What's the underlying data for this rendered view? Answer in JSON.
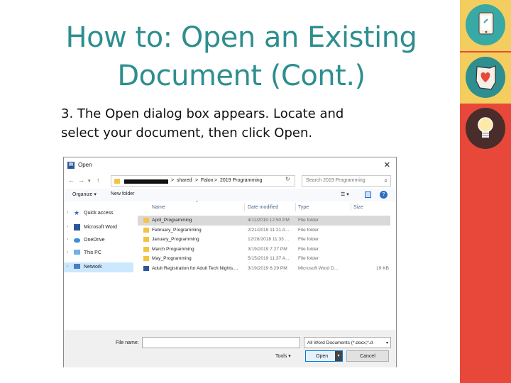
{
  "slide": {
    "title_line1": "How to: Open an Existing",
    "title_line2": "Document (Cont.)",
    "body_line1": "3.  The Open dialog box appears.  Locate and",
    "body_line2": "select your document, then click Open."
  },
  "dialog": {
    "title": "Open",
    "close_glyph": "✕",
    "address": {
      "crumb_1": "shared",
      "crumb_2": "Falon",
      "crumb_3": "2019 Programming",
      "separator": ">"
    },
    "search_placeholder": "Search 2019 Programming",
    "toolbar": {
      "organize": "Organize ▾",
      "new_folder": "New folder",
      "help": "?"
    },
    "nav": [
      {
        "label": "Quick access"
      },
      {
        "label": "Microsoft Word"
      },
      {
        "label": "OneDrive"
      },
      {
        "label": "This PC"
      },
      {
        "label": "Network"
      }
    ],
    "columns": {
      "name": "Name",
      "date": "Date modified",
      "type": "Type",
      "size": "Size"
    },
    "files": [
      {
        "name": "April_Programming",
        "date": "4/11/2019 12:50 PM",
        "type": "File folder",
        "size": ""
      },
      {
        "name": "February_Programming",
        "date": "2/21/2019 11:21 A...",
        "type": "File folder",
        "size": ""
      },
      {
        "name": "January_Programming",
        "date": "12/28/2018 11:33 ...",
        "type": "File folder",
        "size": ""
      },
      {
        "name": "March Programming",
        "date": "3/19/2019 7:27 PM",
        "type": "File folder",
        "size": ""
      },
      {
        "name": "May_Programming",
        "date": "5/15/2019 11:37 A...",
        "type": "File folder",
        "size": ""
      },
      {
        "name": "Adult Registration for Adult Tech Nights....",
        "date": "3/19/2019 6:29 PM",
        "type": "Microsoft Word D...",
        "size": "19 KB"
      }
    ],
    "file_name_label": "File name:",
    "file_name_value": "",
    "filter": "All Word Documents (*.docx;*.d",
    "tools": "Tools  ▾",
    "open_button": "Open",
    "cancel_button": "Cancel"
  },
  "colors": {
    "title": "#2e8e8f",
    "side_red": "#e8483a",
    "side_yellow": "#f3ce5e",
    "selected_row": "#d9d9d9",
    "nav_selected": "#cce8ff"
  },
  "icons": [
    "word-icon",
    "back-arrow-icon",
    "forward-arrow-icon",
    "up-arrow-icon",
    "folder-icon",
    "refresh-icon",
    "search-icon",
    "view-options-icon",
    "preview-pane-icon",
    "help-icon",
    "star-icon",
    "onedrive-icon",
    "pc-icon",
    "network-icon",
    "word-doc-icon",
    "close-icon"
  ]
}
